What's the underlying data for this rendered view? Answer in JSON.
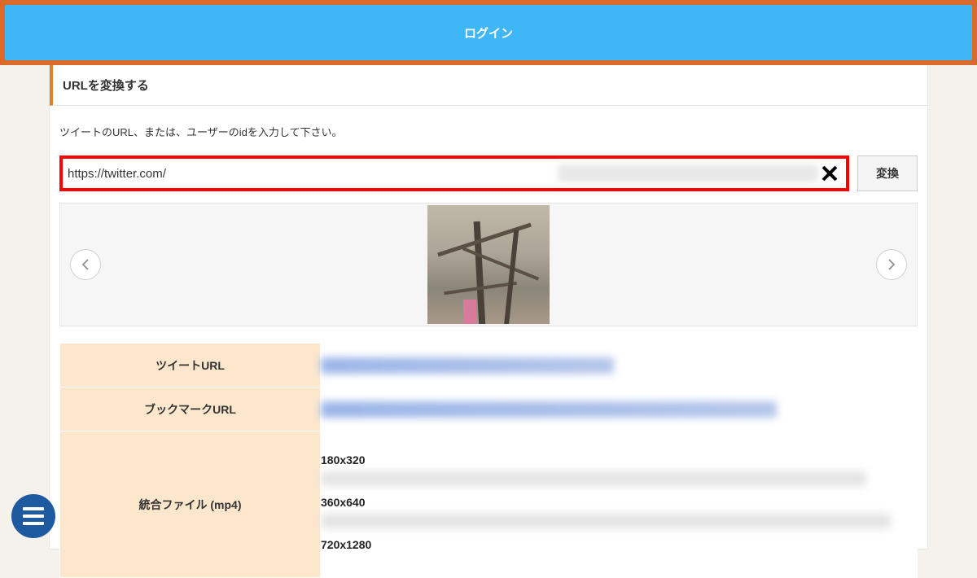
{
  "header": {
    "login_label": "ログイン"
  },
  "section": {
    "title": "URLを変換する",
    "instruction": "ツイートのURL、または、ユーザーのidを入力して下さい。"
  },
  "input": {
    "value": "https://twitter.com/",
    "convert_label": "変換"
  },
  "results": {
    "tweet_url_label": "ツイートURL",
    "bookmark_url_label": "ブックマークURL",
    "merged_file_label": "統合ファイル (mp4)",
    "resolutions": [
      "180x320",
      "360x640",
      "720x1280"
    ]
  }
}
